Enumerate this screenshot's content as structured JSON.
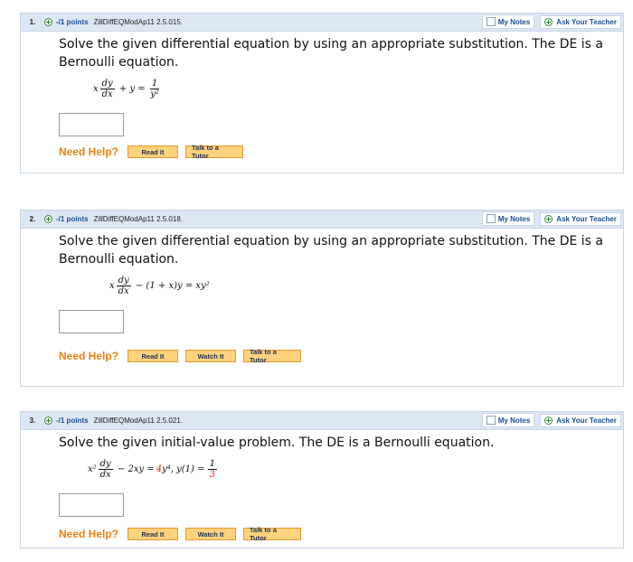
{
  "questions": [
    {
      "number": "1.",
      "points": "-/1 points",
      "id": "ZillDiffEQModAp11 2.5.015.",
      "my_notes": "My Notes",
      "ask_teacher": "Ask Your Teacher",
      "text": "Solve the given differential equation by using an appropriate substitution. The DE is a Bernoulli equation.",
      "equation": {
        "lead": "x",
        "num": "dy",
        "den": "dx",
        "mid": "+ y =",
        "rnum": "1",
        "rden": "y²"
      },
      "need_help": "Need Help?",
      "buttons": [
        "Read It",
        "Talk to a Tutor"
      ]
    },
    {
      "number": "2.",
      "points": "-/1 points",
      "id": "ZillDiffEQModAp11 2.5.018.",
      "my_notes": "My Notes",
      "ask_teacher": "Ask Your Teacher",
      "text": "Solve the given differential equation by using an appropriate substitution. The DE is a Bernoulli equation.",
      "equation": {
        "lead": "x",
        "num": "dy",
        "den": "dx",
        "rest": "− (1 + x)y = xy²"
      },
      "need_help": "Need Help?",
      "buttons": [
        "Read It",
        "Watch It",
        "Talk to a Tutor"
      ]
    },
    {
      "number": "3.",
      "points": "-/1 points",
      "id": "ZillDiffEQModAp11 2.5.021.",
      "my_notes": "My Notes",
      "ask_teacher": "Ask Your Teacher",
      "text": "Solve the given initial-value problem. The DE is a Bernoulli equation.",
      "equation": {
        "lead": "x²",
        "num": "dy",
        "den": "dx",
        "mid": "− 2xy =",
        "coef": "4",
        "after": "y⁴,   y(1) =",
        "rnum": "1",
        "rden": "3"
      },
      "need_help": "Need Help?",
      "buttons": [
        "Read It",
        "Watch It",
        "Talk to a Tutor"
      ]
    }
  ]
}
